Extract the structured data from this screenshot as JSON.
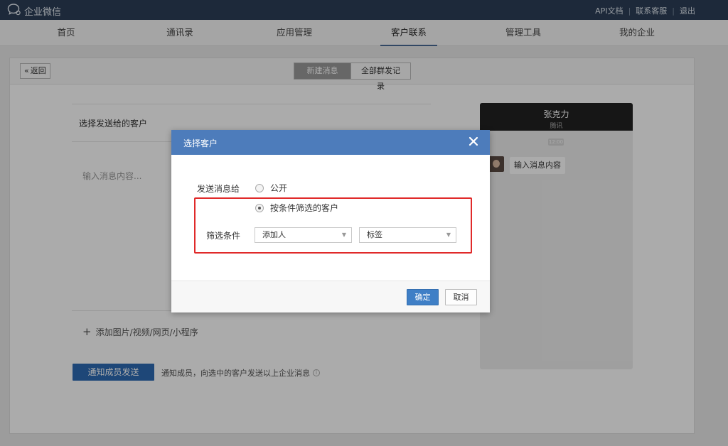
{
  "topbar": {
    "logo_text": "企业微信",
    "links": [
      "API文档",
      "联系客服",
      "退出"
    ]
  },
  "nav": {
    "items": [
      "首页",
      "通讯录",
      "应用管理",
      "客户联系",
      "管理工具",
      "我的企业"
    ],
    "active": "客户联系"
  },
  "subheader": {
    "back_label": "返回",
    "tabs": [
      "新建消息",
      "全部群发记录"
    ]
  },
  "compose": {
    "title": "选择发送给的客户",
    "placeholder": "输入消息内容...",
    "attach_label": "添加图片/视频/网页/小程序"
  },
  "send": {
    "button_label": "通知成员发送",
    "tip": "通知成员，向选中的客户发送以上企业消息"
  },
  "preview": {
    "name": "张克力",
    "subtitle": "腾讯",
    "time": "12:00",
    "bubble": "输入消息内容"
  },
  "dialog": {
    "title": "选择客户",
    "send_to_label": "发送消息给",
    "option_public": "公开",
    "option_filter": "按条件筛选的客户",
    "selected_option": "按条件筛选的客户",
    "filter_label": "筛选条件",
    "select_adder": "添加人",
    "select_tag": "标签",
    "ok_label": "确定",
    "cancel_label": "取消"
  },
  "colors": {
    "topbar": "#2c3e57",
    "dialog_header": "#4d7cbb",
    "primary_button": "#2e6bb3",
    "highlight_border": "#e02a2a"
  }
}
